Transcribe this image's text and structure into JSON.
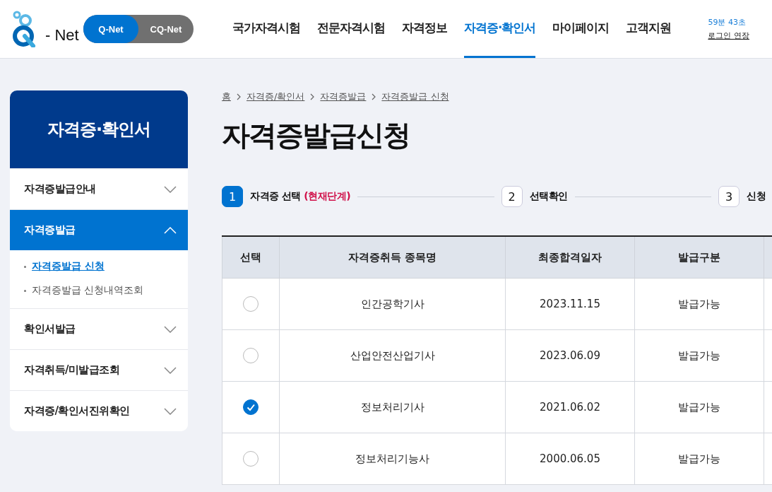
{
  "header": {
    "logo": {
      "text": "- Net"
    },
    "site_switch": [
      {
        "label": "Q-Net",
        "selected": true
      },
      {
        "label": "CQ-Net",
        "selected": false
      }
    ],
    "nav": [
      {
        "label": "국가자격시험",
        "selected": false
      },
      {
        "label": "전문자격시험",
        "selected": false
      },
      {
        "label": "자격정보",
        "selected": false
      },
      {
        "label": "자격증·확인서",
        "selected": true
      },
      {
        "label": "마이페이지",
        "selected": false
      },
      {
        "label": "고객지원",
        "selected": false
      }
    ],
    "session": {
      "timer": "59분 43초",
      "extend_link": "로그인 연장"
    }
  },
  "sidebar": {
    "title": "자격증·확인서",
    "items": [
      {
        "label": "자격증발급안내",
        "expanded": false
      },
      {
        "label": "자격증발급",
        "expanded": true,
        "children": [
          {
            "label": "자격증발급 신청",
            "selected": true
          },
          {
            "label": "자격증발급 신청내역조회",
            "selected": false
          }
        ]
      },
      {
        "label": "확인서발급",
        "expanded": false
      },
      {
        "label": "자격취득/미발급조회",
        "expanded": false
      },
      {
        "label": "자격증/확인서진위확인",
        "expanded": false
      }
    ]
  },
  "breadcrumb": [
    "홈",
    "자격증/확인서",
    "자격증발급",
    "자격증발급 신청"
  ],
  "page_title": "자격증발급신청",
  "steps": [
    {
      "number": "1",
      "label": "자격증 선택",
      "note": "(현재단계)",
      "selected": true
    },
    {
      "number": "2",
      "label": "선택확인",
      "selected": false
    },
    {
      "number": "3",
      "label": "신청",
      "selected": false
    }
  ],
  "table": {
    "columns": [
      "선택",
      "자격증취득 종목명",
      "최종합격일자",
      "발급구분"
    ],
    "rows": [
      {
        "selected": false,
        "name": "인간공학기사",
        "date": "2023.11.15",
        "status": "발급가능"
      },
      {
        "selected": false,
        "name": "산업안전산업기사",
        "date": "2023.06.09",
        "status": "발급가능"
      },
      {
        "selected": true,
        "name": "정보처리기사",
        "date": "2021.06.02",
        "status": "발급가능"
      },
      {
        "selected": false,
        "name": "정보처리기능사",
        "date": "2000.06.05",
        "status": "발급가능"
      }
    ]
  }
}
